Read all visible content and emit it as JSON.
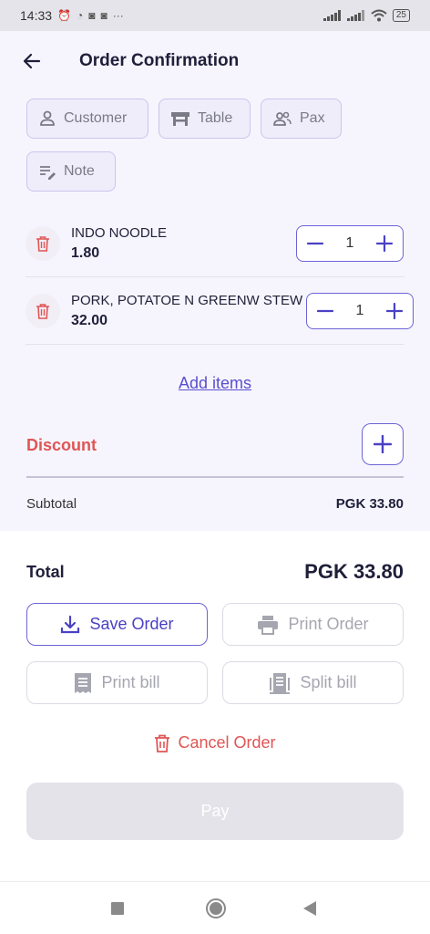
{
  "status_bar": {
    "time": "14:33",
    "battery": "25"
  },
  "header": {
    "title": "Order Confirmation"
  },
  "chips": {
    "customer": "Customer",
    "table": "Table",
    "pax": "Pax",
    "note": "Note"
  },
  "items": [
    {
      "name": "INDO NOODLE",
      "price": "1.80",
      "qty": "1"
    },
    {
      "name": "PORK, POTATOE N GREENW STEW",
      "price": "32.00",
      "qty": "1"
    }
  ],
  "add_items_label": "Add items",
  "discount": {
    "label": "Discount"
  },
  "subtotal": {
    "label": "Subtotal",
    "value": "PGK 33.80"
  },
  "total": {
    "label": "Total",
    "value": "PGK 33.80"
  },
  "actions": {
    "save_order": "Save Order",
    "print_order": "Print Order",
    "print_bill": "Print bill",
    "split_bill": "Split bill",
    "cancel_order": "Cancel Order",
    "pay": "Pay"
  },
  "colors": {
    "accent": "#6c63d8",
    "danger": "#e05555",
    "background_top": "#f6f5fd",
    "disabled": "#e4e3ea"
  },
  "icons": {
    "back": "arrow-left-icon",
    "customer": "person-icon",
    "table": "table-icon",
    "pax": "people-icon",
    "note": "note-edit-icon",
    "trash": "trash-icon",
    "minus": "minus-icon",
    "plus": "plus-icon",
    "save": "download-icon",
    "print": "printer-icon",
    "bill": "receipt-icon",
    "split": "split-bill-icon"
  }
}
